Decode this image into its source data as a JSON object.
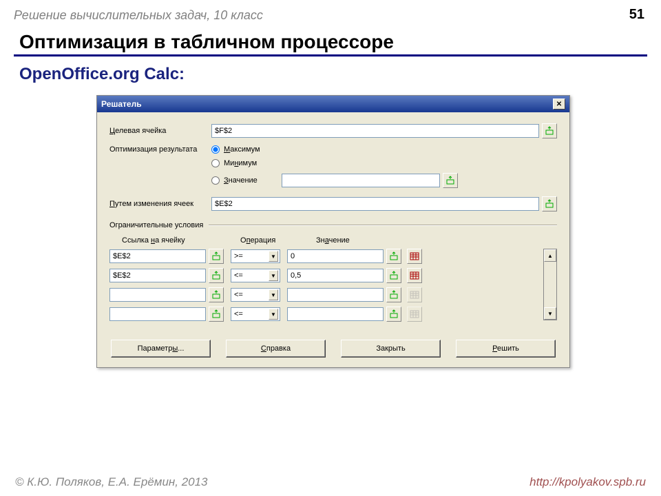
{
  "slide": {
    "header": "Решение вычислительных задач, 10 класс",
    "page_number": "51",
    "title": "Оптимизация в табличном процессоре",
    "subtitle": "OpenOffice.org Calc:"
  },
  "dialog": {
    "title": "Решатель",
    "labels": {
      "target_cell": "Целевая ячейка",
      "optimize_result": "Оптимизация результата",
      "by_changing": "Путем изменения ячеек",
      "constraints_group": "Ограничительные условия",
      "col_ref": "Ссылка на ячейку",
      "col_op": "Операция",
      "col_val": "Значение"
    },
    "target_cell_value": "$F$2",
    "radios": {
      "max": "Максимум",
      "min": "Минимум",
      "value": "Значение"
    },
    "value_field": "",
    "changing_cells": "$E$2",
    "constraints": [
      {
        "ref": "$E$2",
        "op": ">=",
        "val": "0",
        "active": true
      },
      {
        "ref": "$E$2",
        "op": "<=",
        "val": "0,5",
        "active": true
      },
      {
        "ref": "",
        "op": "<=",
        "val": "",
        "active": false
      },
      {
        "ref": "",
        "op": "<=",
        "val": "",
        "active": false
      }
    ],
    "buttons": {
      "params": "Параметры...",
      "help": "Справка",
      "close": "Закрыть",
      "solve": "Решить"
    }
  },
  "footer": {
    "left": "© К.Ю. Поляков, Е.А. Ерёмин, 2013",
    "right": "http://kpolyakov.spb.ru"
  }
}
